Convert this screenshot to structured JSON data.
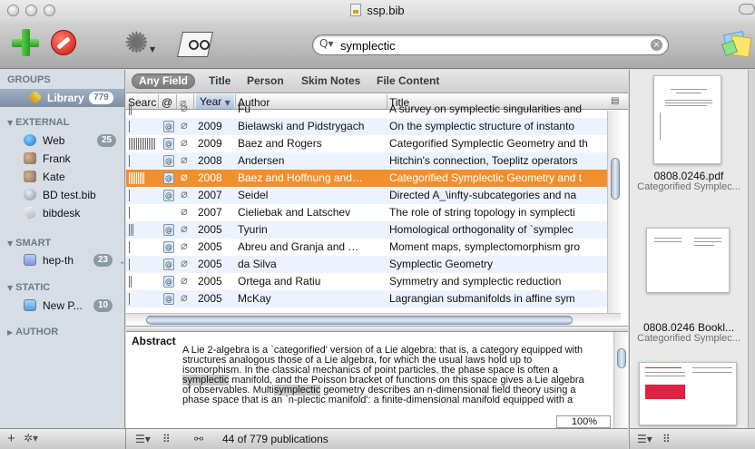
{
  "window": {
    "title": "ssp.bib"
  },
  "toolbar": {
    "search_value": "symplectic",
    "search_icon": "magnifier-icon",
    "buttons": [
      "add-publication-icon",
      "delete-icon",
      "gear-icon",
      "preview-icon",
      "notes-icon"
    ]
  },
  "sidebar": {
    "groups_header": "GROUPS",
    "library": {
      "label": "Library",
      "count": "779"
    },
    "external_header": "EXTERNAL",
    "external_items": [
      {
        "label": "Web",
        "count": "25",
        "icon": "globe-icon"
      },
      {
        "label": "Frank",
        "icon": "shared-icon"
      },
      {
        "label": "Kate",
        "icon": "shared-icon"
      },
      {
        "label": "BD test.bib",
        "icon": "url-icon"
      },
      {
        "label": "bibdesk",
        "icon": "script-icon"
      }
    ],
    "smart_header": "SMART",
    "smart_items": [
      {
        "label": "hep-th",
        "count": "23",
        "icon": "smart-folder-icon"
      }
    ],
    "static_header": "STATIC",
    "static_items": [
      {
        "label": "New P...",
        "count": "10",
        "icon": "folder-icon"
      }
    ],
    "author_header": "AUTHOR"
  },
  "scope_bar": {
    "buttons": [
      "Any Field",
      "Title",
      "Person",
      "Skim Notes",
      "File Content"
    ],
    "active": "Any Field"
  },
  "table": {
    "columns": {
      "search": "Searc",
      "at": "@",
      "clip": "📎",
      "year": "Year",
      "author": "Author",
      "title": "Title"
    },
    "rows": [
      {
        "relevance": 0.1,
        "url": false,
        "clip": true,
        "year": "",
        "author": "Fu",
        "title": "A survey on symplectic singularities and",
        "selected": false
      },
      {
        "relevance": 0.05,
        "url": true,
        "clip": true,
        "year": "2009",
        "author": "Bielawski and Pidstrygach",
        "title": "On the symplectic structure of instanto",
        "selected": false
      },
      {
        "relevance": 1.0,
        "url": true,
        "clip": true,
        "year": "2009",
        "author": "Baez and Rogers",
        "title": "Categorified Symplectic Geometry and th",
        "selected": false
      },
      {
        "relevance": 0.05,
        "url": true,
        "clip": true,
        "year": "2008",
        "author": "Andersen",
        "title": "Hitchin's connection, Toeplitz operators",
        "selected": false
      },
      {
        "relevance": 0.6,
        "url": true,
        "clip": true,
        "year": "2008",
        "author": "Baez and Hoffnung and…",
        "title": "Categorified Symplectic Geometry and t",
        "selected": true
      },
      {
        "relevance": 0.0,
        "url": true,
        "clip": true,
        "year": "2007",
        "author": "Seidel",
        "title": "Directed A_\\infty-subcategories and na",
        "selected": false
      },
      {
        "relevance": 0.0,
        "url": false,
        "clip": true,
        "year": "2007",
        "author": "Cieliebak and Latschev",
        "title": "The role of string topology in symplecti",
        "selected": false
      },
      {
        "relevance": 0.2,
        "url": true,
        "clip": true,
        "year": "2005",
        "author": "Tyurin",
        "title": "Homological orthogonality of `symplec",
        "selected": false
      },
      {
        "relevance": 0.05,
        "url": true,
        "clip": true,
        "year": "2005",
        "author": "Abreu and Granja and …",
        "title": "Moment maps, symplectomorphism gro",
        "selected": false
      },
      {
        "relevance": 0.05,
        "url": true,
        "clip": true,
        "year": "2005",
        "author": "da Silva",
        "title": "Symplectic Geometry",
        "selected": false
      },
      {
        "relevance": 0.1,
        "url": true,
        "clip": true,
        "year": "2005",
        "author": "Ortega and Ratiu",
        "title": "Symmetry and symplectic reduction",
        "selected": false
      },
      {
        "relevance": 0.05,
        "url": true,
        "clip": true,
        "year": "2005",
        "author": "McKay",
        "title": "Lagrangian submanifolds in affine sym",
        "selected": false
      }
    ]
  },
  "abstract": {
    "label": "Abstract",
    "lines": [
      [
        {
          "t": "A Lie 2-algebra is a `categorified' version of a Lie algebra: that is, a category equipped with"
        }
      ],
      [
        {
          "t": "structures analogous those of a Lie algebra, for which the usual laws hold up to"
        }
      ],
      [
        {
          "t": "isomorphism. In the classical mechanics of point particles, the phase space is often a"
        }
      ],
      [
        {
          "t": "symplectic",
          "hl": true
        },
        {
          "t": " manifold, and the Poisson bracket of functions on this space gives a Lie algebra"
        }
      ],
      [
        {
          "t": "of observables. Multi"
        },
        {
          "t": "symplectic",
          "hl": true
        },
        {
          "t": " geometry describes an n-dimensional field theory using a"
        }
      ],
      [
        {
          "t": "phase space that is an `n-plectic manifold': a finite-dimensional manifold equipped with a"
        }
      ]
    ],
    "zoom": "100%"
  },
  "status": {
    "count_text": "44 of 779 publications"
  },
  "preview": {
    "files": [
      {
        "name": "0808.0246.pdf",
        "subtitle": "Categorified Symplec..."
      },
      {
        "name": "0808.0246 Bookl...",
        "subtitle": "Categorified Symplec..."
      }
    ]
  }
}
